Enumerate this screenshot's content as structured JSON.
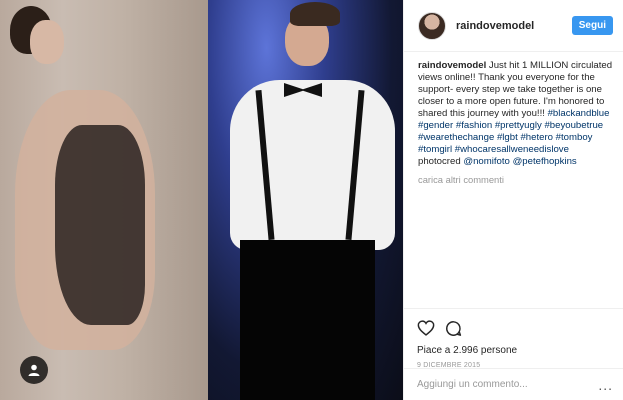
{
  "header": {
    "username": "raindovemodel",
    "follow_label": "Segui"
  },
  "caption": {
    "username": "raindovemodel",
    "text": " Just hit 1 MILLION circulated views online!! Thank you everyone for the support- every step we take together is one closer to a more open future. I'm honored to shared this journey with you!!! ",
    "hashtags": [
      "#blackandblue",
      "#gender",
      "#fashion",
      "#prettyugly",
      "#beyoubetrue",
      "#wearethechange",
      "#lgbt",
      "#hetero",
      "#tomboy",
      "#tomgirl",
      "#whocaresallweneedislove"
    ],
    "credit_prefix": "photocred ",
    "credits": [
      "@nomifoto",
      "@petefhopkins"
    ]
  },
  "load_more_comments": "carica altri commenti",
  "likes": "Piace a 2.996 persone",
  "date": "9 DICEMBRE 2015",
  "comment_input": {
    "placeholder": "Aggiungi un commento..."
  },
  "more_options": "...",
  "icons": {
    "like": "heart-icon",
    "comment": "comment-bubble-icon",
    "user_tag": "user-icon",
    "follow_accent": "#3897f0"
  }
}
